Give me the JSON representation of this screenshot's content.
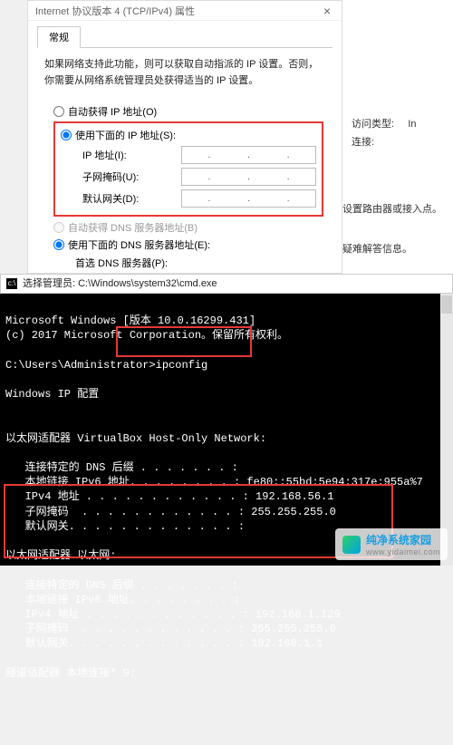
{
  "dialog": {
    "title": "Internet 协议版本 4 (TCP/IPv4) 属性",
    "close": "×",
    "tab": "常规",
    "description": "如果网络支持此功能，则可以获取自动指派的 IP 设置。否则，你需要从网络系统管理员处获得适当的 IP 设置。",
    "auto_ip": "自动获得 IP 地址(O)",
    "use_ip": "使用下面的 IP 地址(S):",
    "ip_label": "IP 地址(I):",
    "mask_label": "子网掩码(U):",
    "gateway_label": "默认网关(D):",
    "auto_dns": "自动获得 DNS 服务器地址(B)",
    "use_dns": "使用下面的 DNS 服务器地址(E):",
    "pref_dns": "首选 DNS 服务器(P):"
  },
  "right": {
    "access_label": "访问类型:",
    "access_value": "In",
    "conn_label": "连接:",
    "tip1": "设置路由器或接入点。",
    "tip2": "疑难解答信息。"
  },
  "console": {
    "title": "选择管理员: C:\\Windows\\system32\\cmd.exe",
    "line1": "Microsoft Windows [版本 10.0.16299.431]",
    "line2": "(c) 2017 Microsoft Corporation。保留所有权利。",
    "prompt": "C:\\Users\\Administrator>",
    "cmd": "ipconfig",
    "cfg_title": "Windows IP 配置",
    "adapter1": "以太网适配器 VirtualBox Host-Only Network:",
    "a1_l1": "   连接特定的 DNS 后缀 . . . . . . . :",
    "a1_l2": "   本地链接 IPv6 地址. . . . . . . . : fe80::55bd:5e94:317e:955a%7",
    "a1_l3": "   IPv4 地址 . . . . . . . . . . . . : 192.168.56.1",
    "a1_l4": "   子网掩码  . . . . . . . . . . . . : 255.255.255.0",
    "a1_l5": "   默认网关. . . . . . . . . . . . . :",
    "adapter2": "以太网适配器 以太网:",
    "a2_l1": "   连接特定的 DNS 后缀 . . . . . . . :",
    "a2_l2": "   本地链接 IPv6 地址. . . . . . . . :",
    "a2_l3": "   IPv4 地址 . . . . . . . . . . . . : 192.168.1.129",
    "a2_l4": "   子网掩码  . . . . . . . . . . . . : 255.255.255.0",
    "a2_l5": "   默认网关. . . . . . . . . . . . . : 192.168.1.1",
    "tunnel": "隧道适配器 本地连接* 9:"
  },
  "stamp": {
    "name": "纯净系统家园",
    "url": "www.yidaimei.com"
  }
}
